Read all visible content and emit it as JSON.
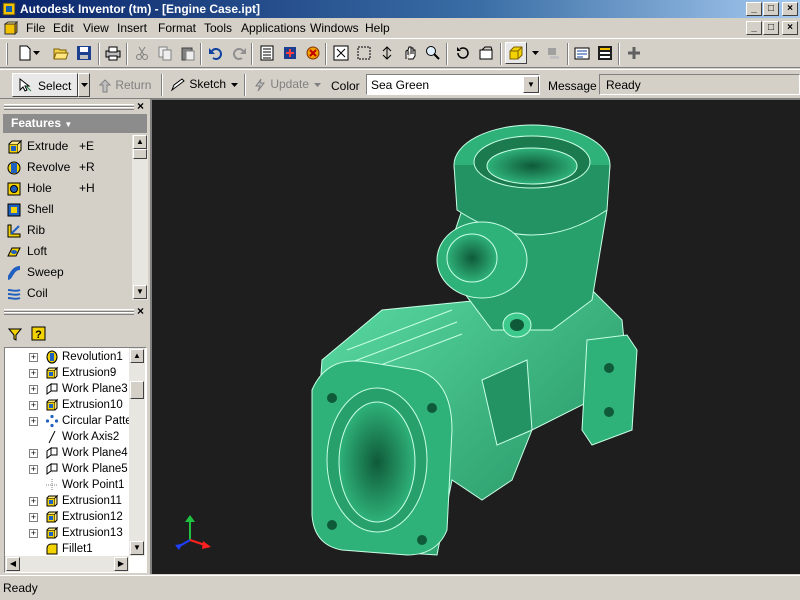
{
  "window": {
    "title": "Autodesk Inventor (tm) - [Engine Case.ipt]",
    "controls": [
      "_",
      "□",
      "×"
    ]
  },
  "menu": {
    "items": [
      "File",
      "Edit",
      "View",
      "Insert",
      "Format",
      "Tools",
      "Applications",
      "Windows",
      "Help"
    ]
  },
  "command_bar": {
    "select_label": "Select",
    "return_label": "Return",
    "sketch_label": "Sketch",
    "update_label": "Update",
    "color_label": "Color",
    "color_value": "Sea Green",
    "message_label": "Message",
    "message_value": "Ready"
  },
  "features_panel": {
    "title": "Features",
    "items": [
      {
        "label": "Extrude",
        "shortcut": "+E",
        "icon": "extrude-icon"
      },
      {
        "label": "Revolve",
        "shortcut": "+R",
        "icon": "revolve-icon"
      },
      {
        "label": "Hole",
        "shortcut": "+H",
        "icon": "hole-icon"
      },
      {
        "label": "Shell",
        "shortcut": "",
        "icon": "shell-icon"
      },
      {
        "label": "Rib",
        "shortcut": "",
        "icon": "rib-icon"
      },
      {
        "label": "Loft",
        "shortcut": "",
        "icon": "loft-icon"
      },
      {
        "label": "Sweep",
        "shortcut": "",
        "icon": "sweep-icon"
      },
      {
        "label": "Coil",
        "shortcut": "",
        "icon": "coil-icon"
      }
    ]
  },
  "browser_panel": {
    "items": [
      {
        "label": "Revolution1",
        "icon": "revolve-feature-icon",
        "expandable": true
      },
      {
        "label": "Extrusion9",
        "icon": "extrusion-icon",
        "expandable": true
      },
      {
        "label": "Work Plane3",
        "icon": "work-plane-icon",
        "expandable": true
      },
      {
        "label": "Extrusion10",
        "icon": "extrusion-icon",
        "expandable": true
      },
      {
        "label": "Circular Patte",
        "icon": "circular-pattern-icon",
        "expandable": true
      },
      {
        "label": "Work Axis2",
        "icon": "work-axis-icon",
        "expandable": false
      },
      {
        "label": "Work Plane4",
        "icon": "work-plane-icon",
        "expandable": true
      },
      {
        "label": "Work Plane5",
        "icon": "work-plane-icon",
        "expandable": true
      },
      {
        "label": "Work Point1",
        "icon": "work-point-icon",
        "expandable": false
      },
      {
        "label": "Extrusion11",
        "icon": "extrusion-icon",
        "expandable": true
      },
      {
        "label": "Extrusion12",
        "icon": "extrusion-icon",
        "expandable": true
      },
      {
        "label": "Extrusion13",
        "icon": "extrusion-icon",
        "expandable": true
      },
      {
        "label": "Fillet1",
        "icon": "fillet-icon",
        "expandable": false
      }
    ]
  },
  "viewport": {
    "background": "#1e1e1e",
    "model_color": "#2fb27a",
    "model_name": "Engine Case"
  },
  "status_bar": {
    "text": "Ready"
  },
  "colors": {
    "titlebar_start": "#0a246a",
    "titlebar_end": "#a6caf0",
    "chrome": "#d4d0c8",
    "features_header": "#8c8c8c"
  }
}
